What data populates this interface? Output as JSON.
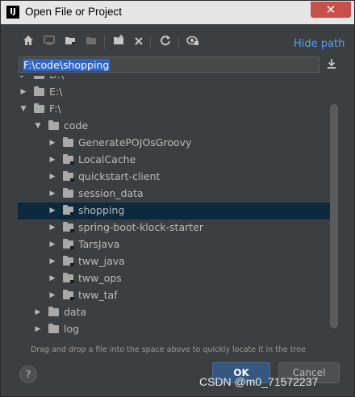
{
  "window": {
    "title": "Open File or Project",
    "app_icon": "IJ",
    "close_glyph": "✕"
  },
  "toolbar": {
    "hide_path_label": "Hide path",
    "icons": [
      "home-icon",
      "desktop-icon",
      "project-folder-icon",
      "module-folder-icon",
      "new-folder-icon",
      "delete-icon",
      "refresh-icon",
      "show-hidden-icon"
    ]
  },
  "path": {
    "value": "F:\\code\\shopping"
  },
  "tree": {
    "items": [
      {
        "label": "D:\\",
        "expanded": false,
        "module": false
      },
      {
        "label": "E:\\",
        "expanded": false,
        "module": false
      },
      {
        "label": "F:\\",
        "expanded": true,
        "module": false
      },
      {
        "label": "code",
        "expanded": true,
        "module": false
      },
      {
        "label": "GeneratePOJOsGroovy",
        "expanded": false,
        "module": false
      },
      {
        "label": "LocalCache",
        "expanded": false,
        "module": true
      },
      {
        "label": "quickstart-client",
        "expanded": false,
        "module": true
      },
      {
        "label": "session_data",
        "expanded": false,
        "module": false
      },
      {
        "label": "shopping",
        "expanded": false,
        "module": true,
        "selected": true
      },
      {
        "label": "spring-boot-klock-starter",
        "expanded": false,
        "module": true
      },
      {
        "label": "TarsJava",
        "expanded": false,
        "module": true
      },
      {
        "label": "tww_java",
        "expanded": false,
        "module": true
      },
      {
        "label": "tww_ops",
        "expanded": false,
        "module": true
      },
      {
        "label": "tww_taf",
        "expanded": false,
        "module": true
      },
      {
        "label": "data",
        "expanded": false,
        "module": false
      },
      {
        "label": "log",
        "expanded": false,
        "module": false
      }
    ]
  },
  "hint": "Drag and drop a file into the space above to quickly locate it in the tree",
  "buttons": {
    "help": "?",
    "ok": "OK",
    "cancel": "Cancel"
  },
  "watermark": "CSDN @m0_71572237",
  "colors": {
    "background": "#3c3f41",
    "selection": "#0d293e",
    "accent_link": "#589df6",
    "ok_button": "#365880"
  }
}
